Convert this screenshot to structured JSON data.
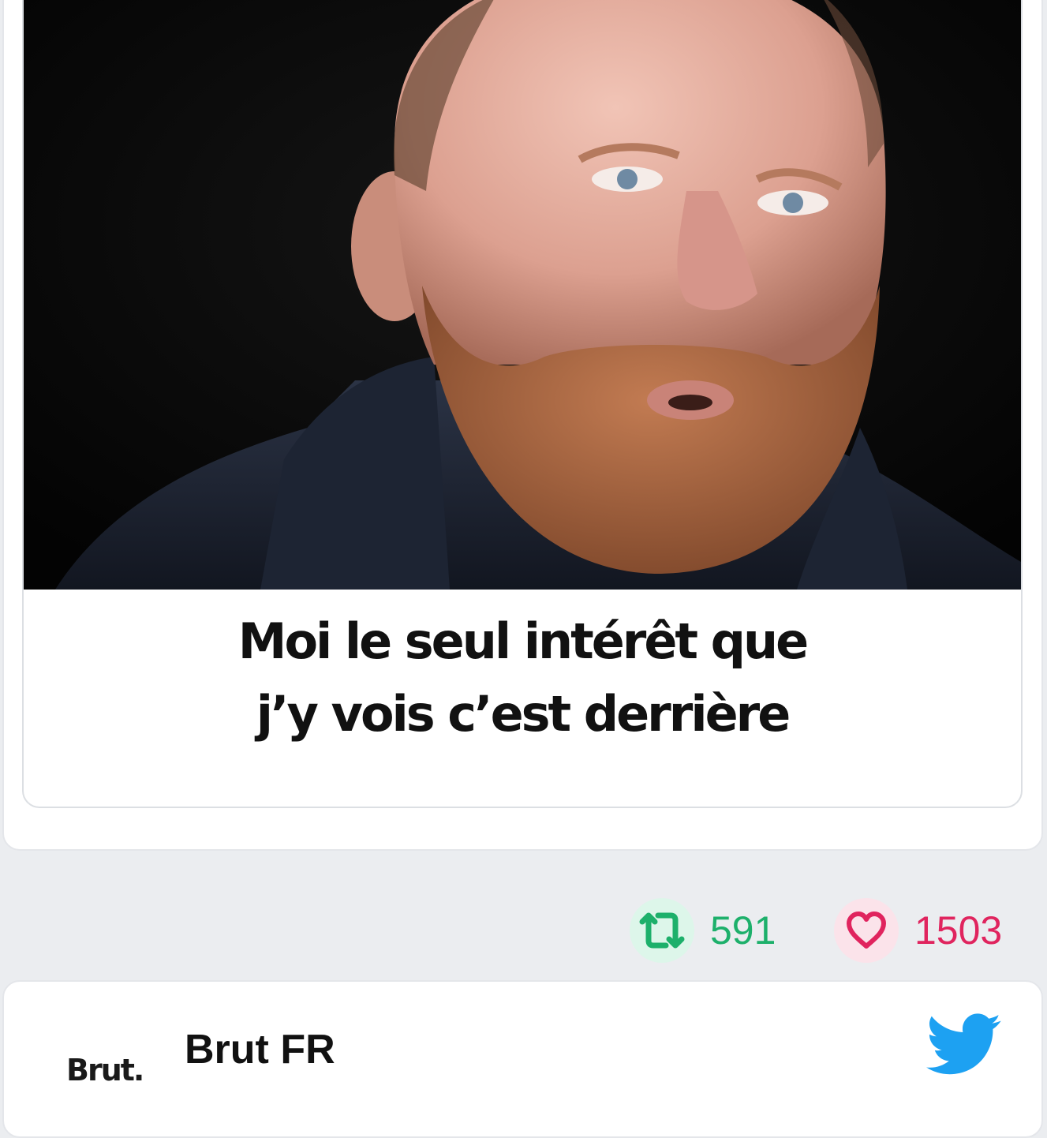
{
  "post": {
    "caption_line1": "Moi le seul intérêt que",
    "caption_line2": "j’y vois c’est derrière"
  },
  "stats": {
    "retweets": "591",
    "likes": "1503"
  },
  "next_post": {
    "author_name": "Brut FR",
    "avatar_text": "Brut."
  },
  "colors": {
    "retweet": "#1db06b",
    "like": "#e0245e",
    "twitter": "#1da1f2"
  },
  "icons": [
    "retweet-icon",
    "heart-icon",
    "twitter-bird-icon"
  ]
}
